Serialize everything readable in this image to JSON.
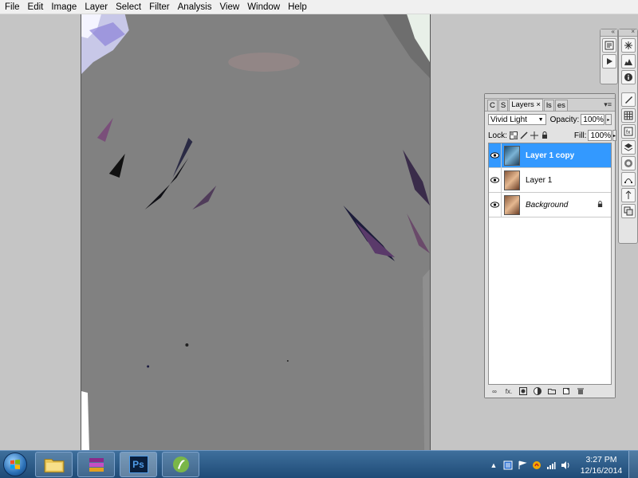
{
  "menubar": {
    "items": [
      "File",
      "Edit",
      "Image",
      "Layer",
      "Select",
      "Filter",
      "Analysis",
      "View",
      "Window",
      "Help"
    ]
  },
  "dock": {
    "group1": [
      "history-icon",
      "actions-icon"
    ],
    "group2": [
      "histogram-icon",
      "info-icon"
    ],
    "group3": [
      "brushes-icon",
      "channels-grid-icon",
      "styles-icon",
      "layers-icon",
      "masks-icon",
      "paths-icon",
      "adjustments-icon",
      "clone-source-icon"
    ]
  },
  "layers_panel": {
    "tabs": [
      "C",
      "S",
      "Layers",
      "ls",
      "es"
    ],
    "active_tab": "Layers",
    "close_glyph": "×",
    "blend_mode": "Vivid Light",
    "opacity_label": "Opacity:",
    "opacity_value": "100%",
    "lock_label": "Lock:",
    "fill_label": "Fill:",
    "fill_value": "100%",
    "layers": [
      {
        "name": "Layer 1 copy",
        "selected": true,
        "locked": false
      },
      {
        "name": "Layer 1",
        "selected": false,
        "locked": false
      },
      {
        "name": "Background",
        "selected": false,
        "locked": true
      }
    ],
    "footer_icons": [
      "link-layers-icon",
      "fx-icon",
      "mask-icon",
      "adjustment-layer-icon",
      "group-icon",
      "new-layer-icon",
      "delete-icon"
    ],
    "fx_label": "fx."
  },
  "taskbar": {
    "apps": [
      "explorer",
      "winrar",
      "photoshop",
      "coreldraw"
    ],
    "ps_label": "Ps",
    "time": "3:27 PM",
    "date": "12/16/2014"
  },
  "colors": {
    "selection": "#3399ff",
    "canvas_gray": "#818181",
    "workspace": "#c5c5c5"
  }
}
